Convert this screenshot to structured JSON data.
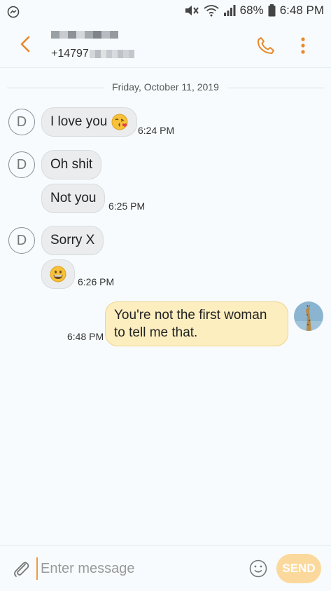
{
  "status_bar": {
    "battery": "68%",
    "time": "6:48 PM",
    "icons": [
      "messenger-icon",
      "mute-icon",
      "wifi-icon",
      "signal-icon",
      "battery-icon"
    ]
  },
  "header": {
    "phone_number": "+14797",
    "icons": [
      "back-arrow-icon",
      "phone-icon",
      "more-vert-icon"
    ],
    "accent_color": "#e8892b"
  },
  "conversation": {
    "date": "Friday, October 11, 2019",
    "contact_initial": "D",
    "messages": [
      {
        "direction": "in",
        "text": "I love you",
        "emoji": "kiss-emoji",
        "time": "6:24 PM"
      },
      {
        "direction": "in",
        "text": "Oh shit",
        "time": ""
      },
      {
        "direction": "in",
        "text": "Not you",
        "time": "6:25 PM"
      },
      {
        "direction": "in",
        "text": "Sorry X",
        "time": ""
      },
      {
        "direction": "in",
        "text": "",
        "emoji": "grin-emoji",
        "time": "6:26 PM"
      },
      {
        "direction": "out",
        "text": "You're not the first woman to tell me that.",
        "time": "6:48 PM"
      }
    ]
  },
  "composer": {
    "placeholder": "Enter message",
    "send_label": "SEND",
    "send_color": "#fbd99c"
  }
}
